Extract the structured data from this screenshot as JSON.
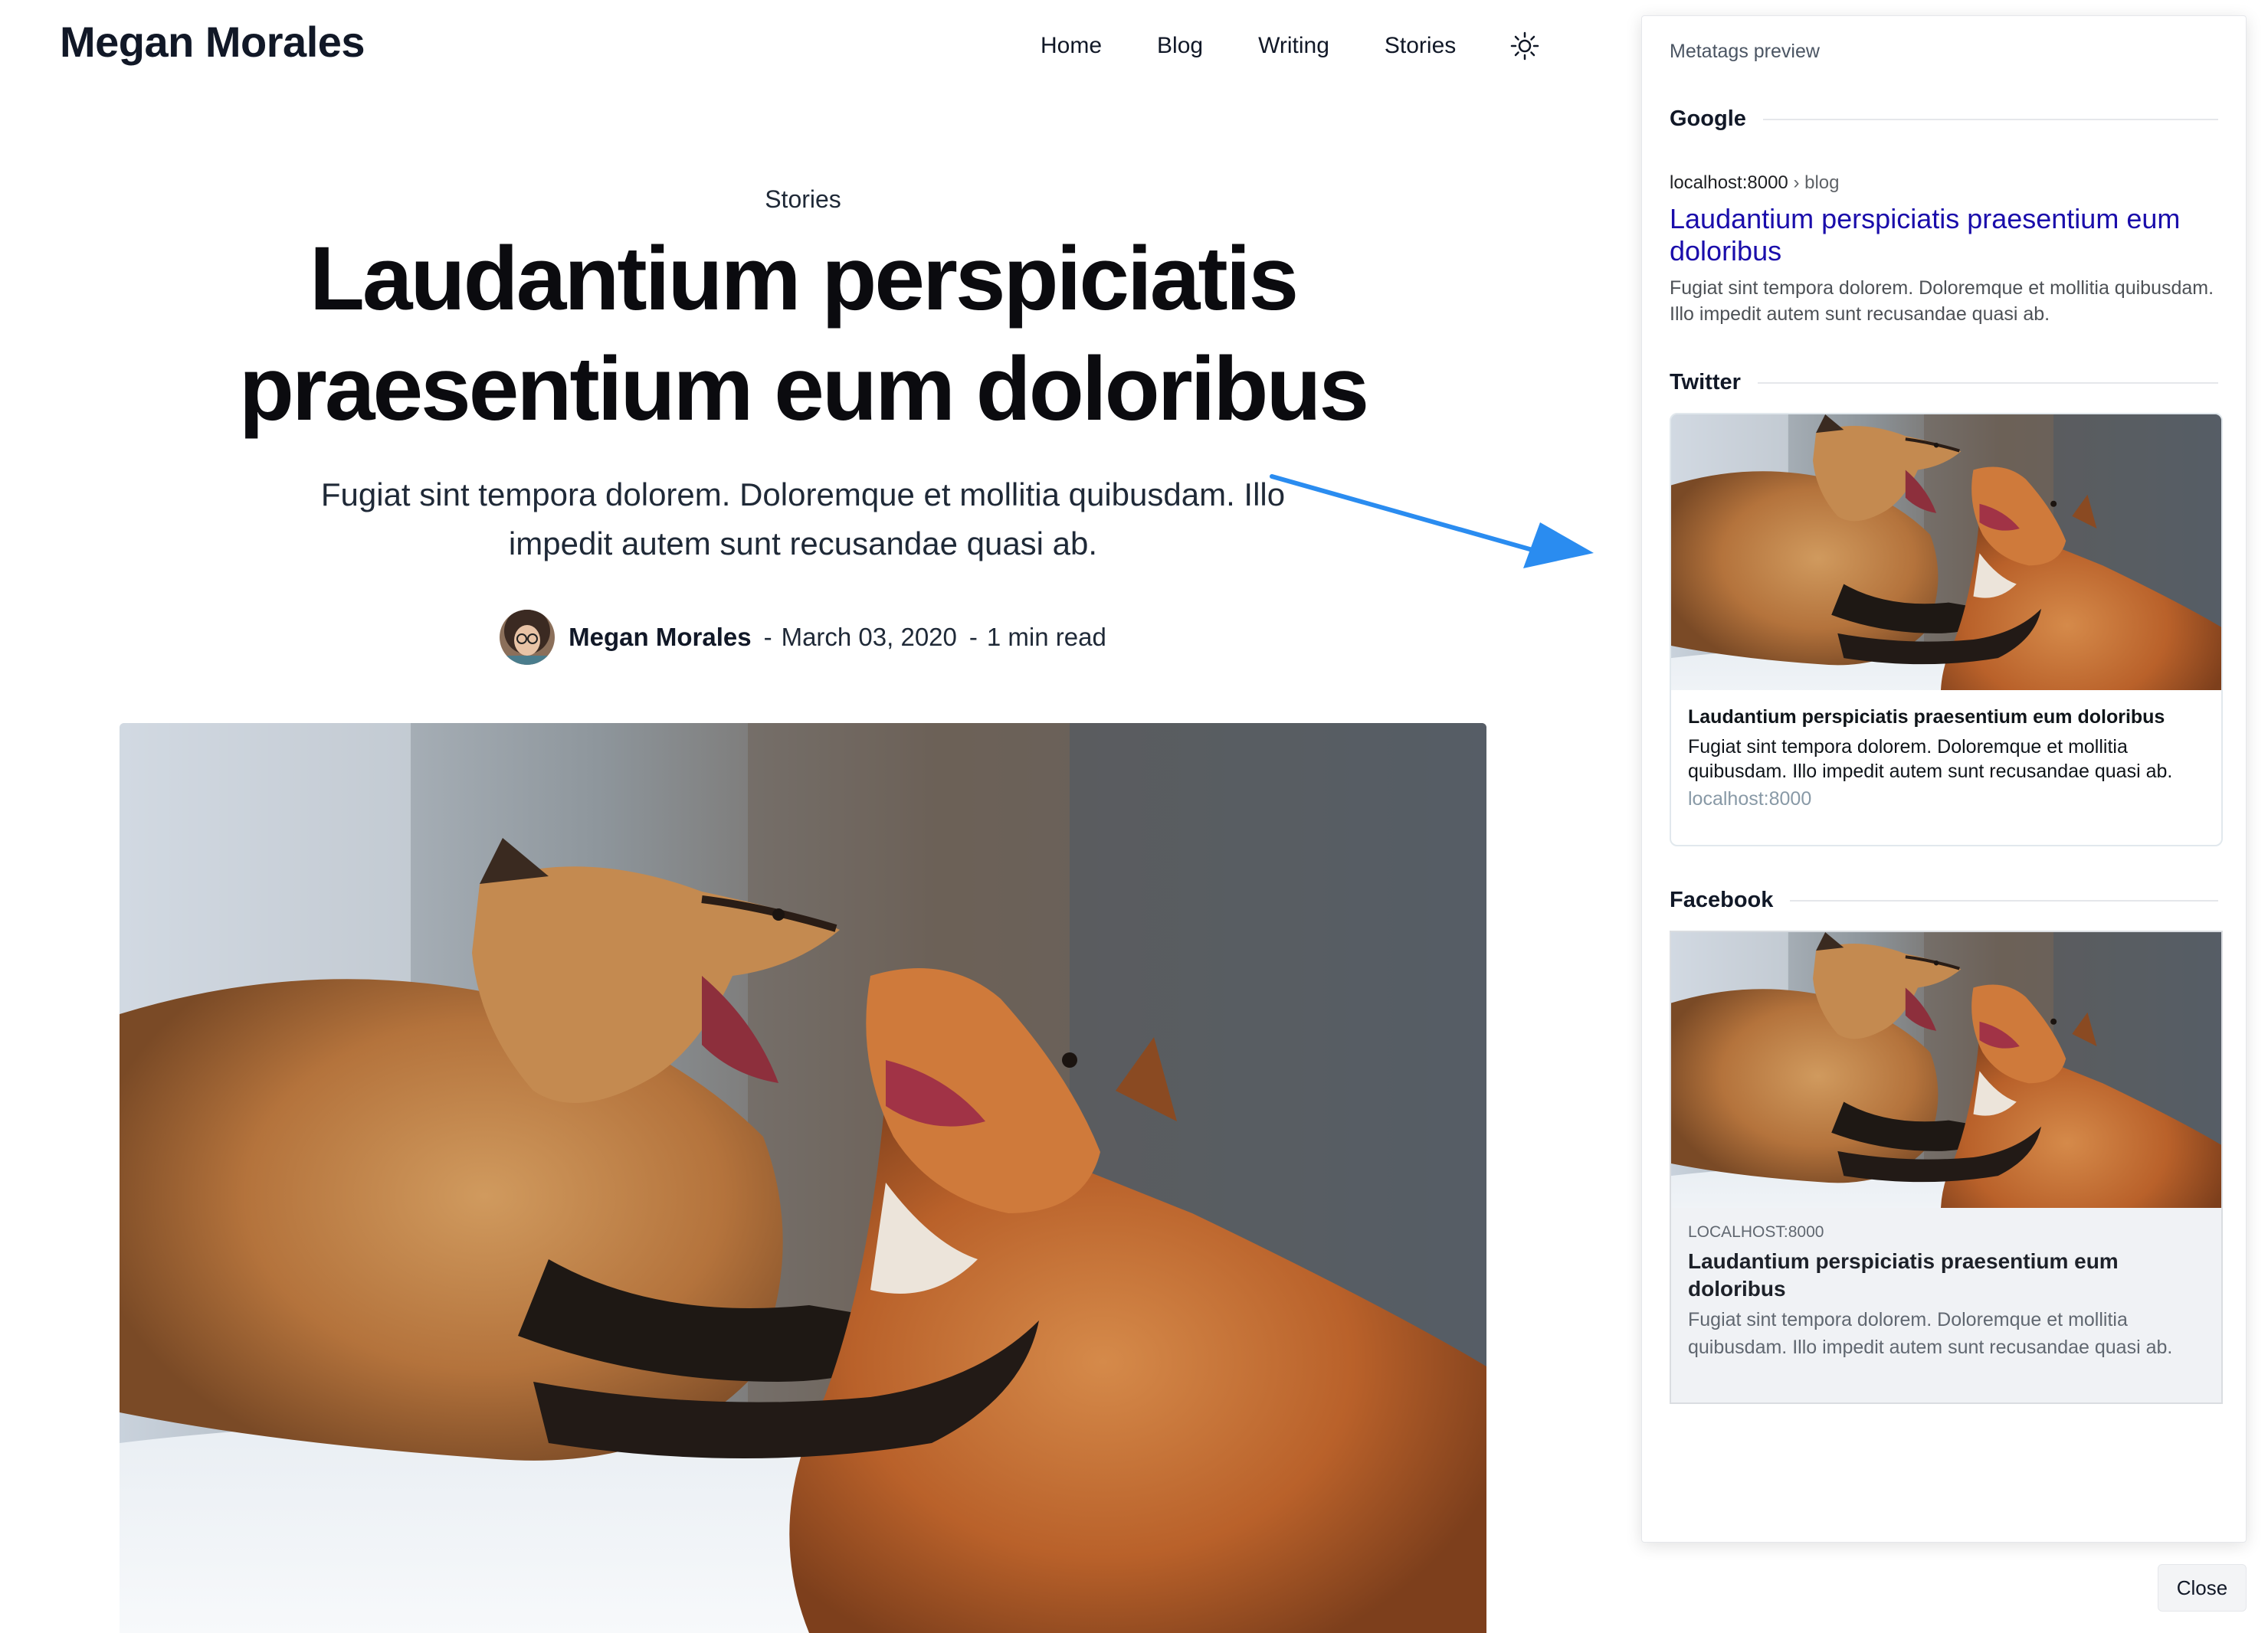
{
  "site": {
    "title": "Megan Morales"
  },
  "nav": {
    "items": [
      "Home",
      "Blog",
      "Writing",
      "Stories"
    ],
    "theme_icon": "sun-icon"
  },
  "article": {
    "category": "Stories",
    "title": "Laudantium perspiciatis praesentium eum doloribus",
    "excerpt": "Fugiat sint tempora dolorem. Doloremque et mollitia quibusdam. Illo impedit autem sunt recusandae quasi ab.",
    "author": "Megan Morales",
    "date": "March 03, 2020",
    "read_time": "1 min read",
    "separator": "-"
  },
  "annotation": {
    "arrow_color": "#2a8cf0"
  },
  "preview": {
    "title": "Metatags preview",
    "google": {
      "heading": "Google",
      "url_host": "localhost:8000",
      "url_path": "› blog",
      "title": "Laudantium perspiciatis praesentium eum doloribus",
      "description": "Fugiat sint tempora dolorem. Doloremque et mollitia quibusdam. Illo impedit autem sunt recusandae quasi ab.",
      "title_color": "#1a0dab"
    },
    "twitter": {
      "heading": "Twitter",
      "title": "Laudantium perspiciatis praesentium eum doloribus",
      "description": "Fugiat sint tempora dolorem. Doloremque et mollitia quibusdam. Illo impedit autem sunt recusandae quasi ab.",
      "domain": "localhost:8000"
    },
    "facebook": {
      "heading": "Facebook",
      "domain": "LOCALHOST:8000",
      "title": "Laudantium perspiciatis praesentium eum doloribus",
      "description": "Fugiat sint tempora dolorem. Doloremque et mollitia quibusdam. Illo impedit autem sunt recusandae quasi ab."
    },
    "close_label": "Close"
  }
}
